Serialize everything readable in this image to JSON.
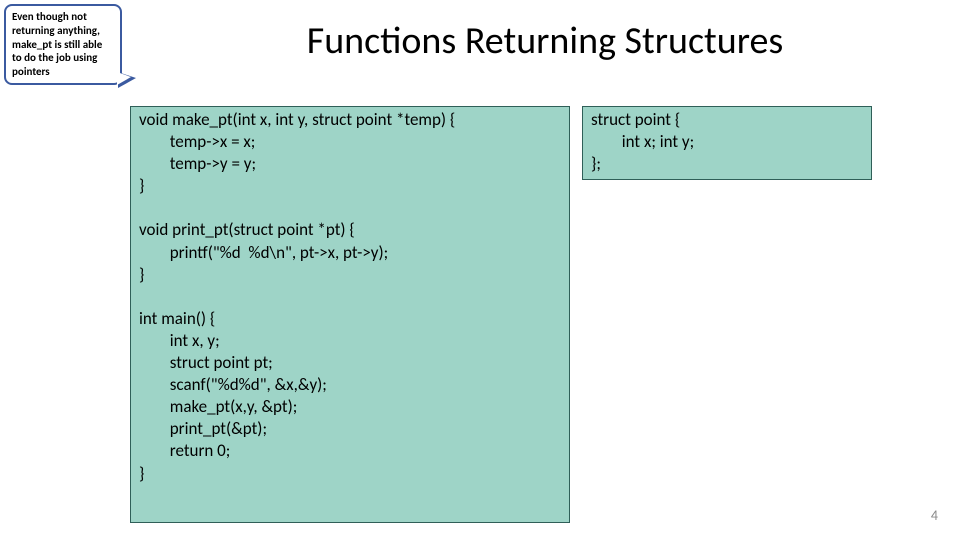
{
  "callout": {
    "text": "Even though not returning anything, make_pt is still able to do the job using pointers"
  },
  "title": "Functions Returning Structures",
  "code_left": "void make_pt(int x, int y, struct point *temp) {\n        temp->x = x;\n        temp->y = y;\n}\n\nvoid print_pt(struct point *pt) {\n        printf(\"%d  %d\\n\", pt->x, pt->y);\n}\n\nint main() {\n        int x, y;\n        struct point pt;\n        scanf(\"%d%d\", &x,&y);\n        make_pt(x,y, &pt);\n        print_pt(&pt);\n        return 0;\n}",
  "code_right": "struct point {\n        int x; int y;\n};",
  "page_number": "4"
}
